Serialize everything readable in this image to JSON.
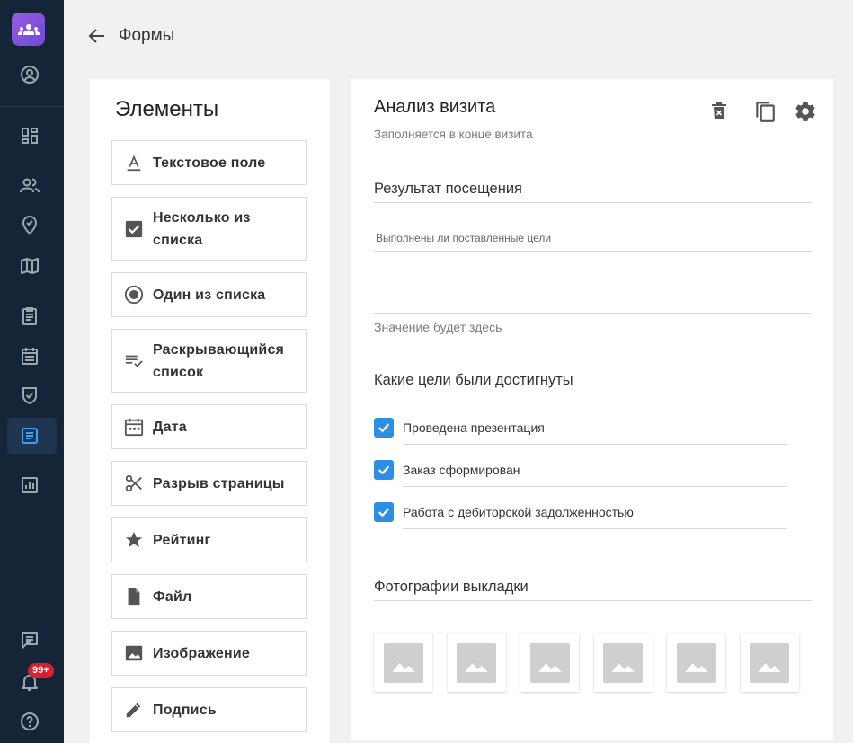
{
  "header": {
    "title": "Формы"
  },
  "elements_panel": {
    "title": "Элементы",
    "items": [
      {
        "label": "Текстовое поле",
        "icon": "text-field-icon"
      },
      {
        "label": "Несколько из списка",
        "icon": "checkbox-icon"
      },
      {
        "label": "Один из списка",
        "icon": "radio-icon"
      },
      {
        "label": "Раскрывающийся список",
        "icon": "dropdown-list-icon"
      },
      {
        "label": "Дата",
        "icon": "calendar-icon"
      },
      {
        "label": "Разрыв страницы",
        "icon": "scissors-icon"
      },
      {
        "label": "Рейтинг",
        "icon": "star-icon"
      },
      {
        "label": "Файл",
        "icon": "file-icon"
      },
      {
        "label": "Изображение",
        "icon": "image-icon"
      },
      {
        "label": "Подпись",
        "icon": "pencil-icon"
      }
    ]
  },
  "form": {
    "title": "Анализ визита",
    "subtitle": "Заполняется в конце визита",
    "section_result": "Результат посещения",
    "question_label": "Выполнены ли поставленные цели",
    "value_placeholder": "Значение будет здесь",
    "section_goals": "Какие цели были достигнуты",
    "goals": [
      {
        "label": "Проведена презентация",
        "checked": true
      },
      {
        "label": "Заказ сформирован",
        "checked": true
      },
      {
        "label": "Работа с дебиторской задолженностью",
        "checked": true
      }
    ],
    "section_photos": "Фотографии выкладки",
    "photo_count": 6
  },
  "sidebar": {
    "notification_badge": "99+",
    "active_item": "forms"
  },
  "colors": {
    "sidebar_bg": "#152538",
    "accent": "#2d8fe3",
    "badge": "#d9202c"
  }
}
